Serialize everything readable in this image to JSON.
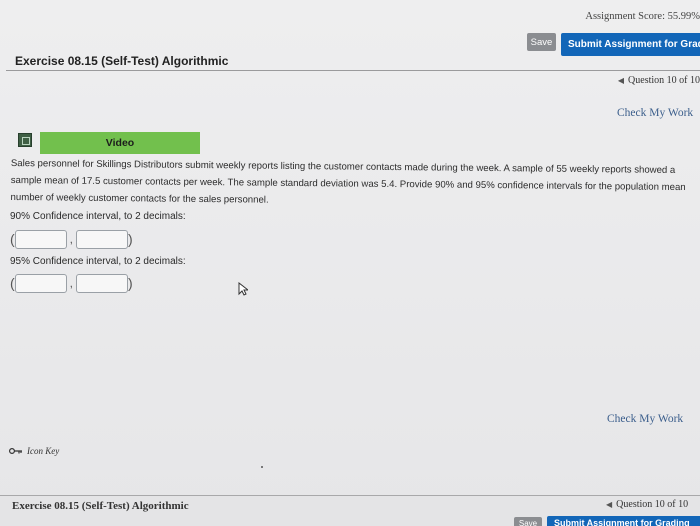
{
  "header": {
    "assignment_score": "Assignment Score: 55.99%",
    "save_label": "Save",
    "submit_label": "Submit Assignment for Grading"
  },
  "exercise": {
    "title": "Exercise 08.15 (Self-Test) Algorithmic",
    "question_nav": "Question 10 of 10",
    "check_my_work": "Check My Work"
  },
  "video": {
    "label": "Video"
  },
  "problem": {
    "text": "Sales personnel for Skillings Distributors submit weekly reports listing the customer contacts made during the week. A sample of 55 weekly reports showed a sample mean of 17.5 customer contacts per week. The sample standard deviation was 5.4. Provide 90% and 95% confidence intervals for the population mean number of weekly customer contacts for the sales personnel."
  },
  "intervals": [
    {
      "label": "90% Confidence interval, to 2 decimals:",
      "open": "(",
      "separator": ",",
      "close": ")",
      "lower_value": "",
      "upper_value": ""
    },
    {
      "label": "95% Confidence interval, to 2 decimals:",
      "open": "(",
      "separator": ",",
      "close": ")",
      "lower_value": "",
      "upper_value": ""
    }
  ],
  "icon_key": {
    "label": "Icon Key",
    "icon": "key-icon"
  },
  "footer": {
    "exercise_title": "Exercise 08.15 (Self-Test) Algorithmic",
    "question_nav": "Question 10 of 10",
    "save_label": "Save",
    "submit_label": "Submit Assignment for Grading"
  },
  "colors": {
    "submit_blue": "#1266b8",
    "video_green": "#72c04d",
    "link_blue": "#3b5e8c",
    "save_gray": "#8b8d91"
  }
}
